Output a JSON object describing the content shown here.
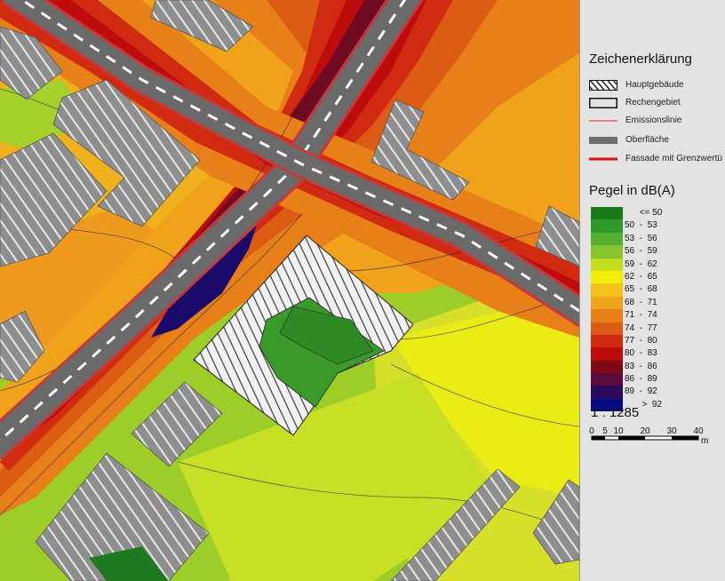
{
  "legend": {
    "title": "Zeichenerklärung",
    "items": [
      {
        "label": "Hauptgebäude",
        "symbol": "hatched-box-icon"
      },
      {
        "label": "Rechengebiet",
        "symbol": "outline-box-icon"
      },
      {
        "label": "Emissionslinie",
        "symbol": "thin-red-line-icon"
      },
      {
        "label": "Oberfläche",
        "symbol": "gray-bar-icon"
      },
      {
        "label": "Fassade mit Grenzwertü",
        "symbol": "thick-red-line-icon"
      }
    ]
  },
  "noise_scale": {
    "title": "Pegel in dB(A)",
    "classes": [
      {
        "label": "      <= 50",
        "color": "#1a7a1a"
      },
      {
        "label": "50  -  53",
        "color": "#2f9a2a"
      },
      {
        "label": "53  -  56",
        "color": "#56b030"
      },
      {
        "label": "56  -  59",
        "color": "#86c52e"
      },
      {
        "label": "59  -  62",
        "color": "#c2dc1e"
      },
      {
        "label": "62  -  65",
        "color": "#f2ee0a"
      },
      {
        "label": "65  -  68",
        "color": "#f5c21c"
      },
      {
        "label": "68  -  71",
        "color": "#f0a21a"
      },
      {
        "label": "71  -  74",
        "color": "#e8801a"
      },
      {
        "label": "74  -  77",
        "color": "#dc5c14"
      },
      {
        "label": "77  -  80",
        "color": "#d02a10"
      },
      {
        "label": "80  -  83",
        "color": "#be0c0c"
      },
      {
        "label": "83  -  86",
        "color": "#7e0a16"
      },
      {
        "label": "86  -  89",
        "color": "#5a0c3c"
      },
      {
        "label": "89  -  92",
        "color": "#2a0a5a"
      },
      {
        "label": "       >  92",
        "color": "#0a0a80"
      }
    ]
  },
  "scale": {
    "ratio": "1 : 1285",
    "ticks": [
      "0",
      "5",
      "10",
      "20",
      "30",
      "40"
    ],
    "unit": "m"
  }
}
